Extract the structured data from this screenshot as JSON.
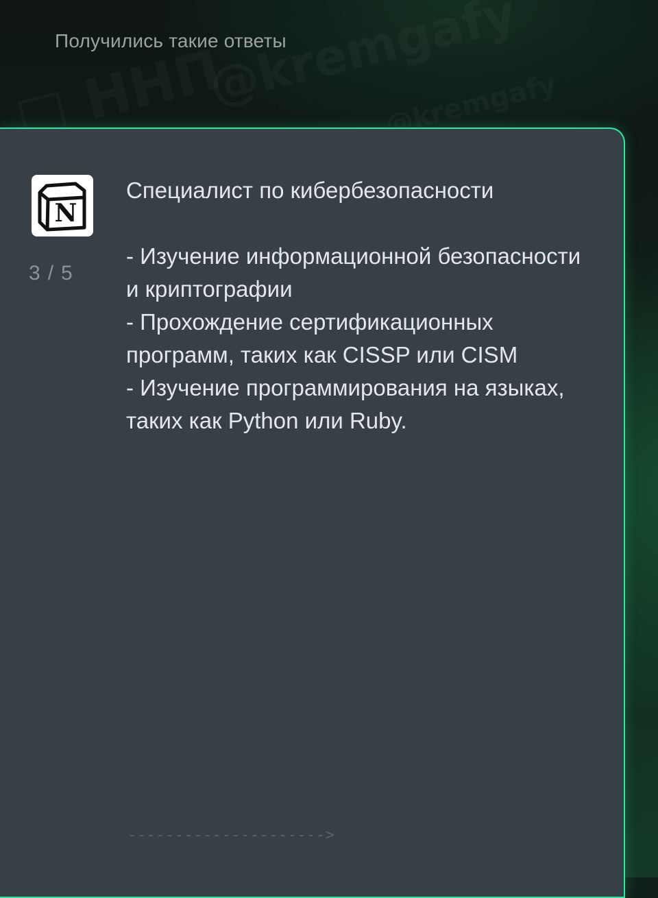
{
  "header": {
    "title": "Получились такие ответы"
  },
  "card": {
    "app_icon": "notion-logo-icon",
    "logo_letter": "N",
    "counter": {
      "current": "3",
      "separator": "/",
      "total": "5"
    },
    "title": "Специалист по кибербезопасности",
    "lines": [
      "- Изучение информационной безопасности и криптографии",
      "- Прохождение сертификационных программ, таких как CISSP или CISM",
      "- Изучение программирования на языках, таких как Python или Ruby."
    ],
    "swipe_hint": "--------------------->"
  },
  "colors": {
    "accent": "#2fe6a0",
    "card_background": "#373f47",
    "page_background": "#0f1614",
    "text_primary": "#e4e7ea",
    "text_muted": "#8b939a"
  }
}
